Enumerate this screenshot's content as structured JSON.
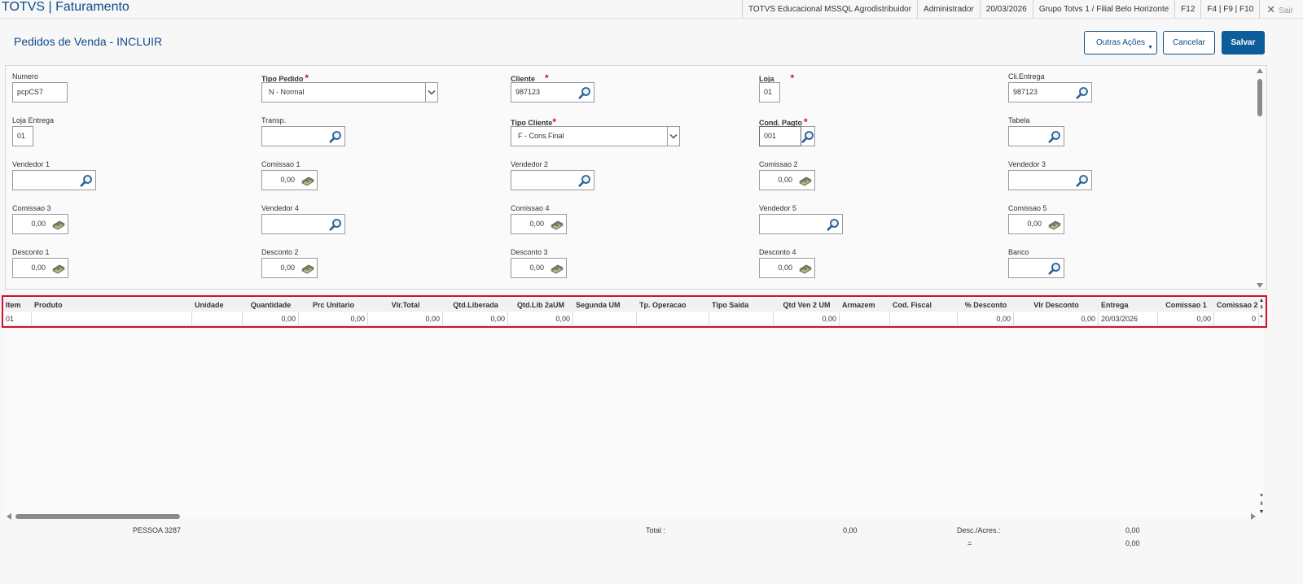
{
  "topbar": {
    "app_title": "TOTVS | Faturamento",
    "environment": "TOTVS Educacional MSSQL Agrodistribuidor",
    "user": "Administrador",
    "date": "20/03/2026",
    "branch": "Grupo Totvs 1 / Filial Belo Horizonte",
    "key_f12": "F12",
    "keys_f4_f9_f10": "F4 | F9 | F10",
    "exit_label": "Sair"
  },
  "page": {
    "title": "Pedidos de Venda - INCLUIR",
    "btn_outras": "Outras Ações",
    "btn_cancelar": "Cancelar",
    "btn_salvar": "Salvar"
  },
  "form": {
    "numero": {
      "label": "Numero",
      "value": "pcpCS7"
    },
    "tipo_pedido": {
      "label": "Tipo Pedido",
      "value": "N - Normal"
    },
    "cliente": {
      "label": "Cliente",
      "value": "987123"
    },
    "loja": {
      "label": "Loja",
      "value": "01"
    },
    "cli_entrega": {
      "label": "Cli.Entrega",
      "value": "987123"
    },
    "loja_entrega": {
      "label": "Loja Entrega",
      "value": "01"
    },
    "transp": {
      "label": "Transp.",
      "value": ""
    },
    "tipo_cliente": {
      "label": "Tipo Cliente",
      "value": "F - Cons.Final"
    },
    "cond_pagto": {
      "label": "Cond. Pagto",
      "value": "001"
    },
    "tabela": {
      "label": "Tabela",
      "value": ""
    },
    "vendedor1": {
      "label": "Vendedor 1",
      "value": ""
    },
    "comissao1": {
      "label": "Comissao 1",
      "value": "0,00"
    },
    "vendedor2": {
      "label": "Vendedor 2",
      "value": ""
    },
    "comissao2": {
      "label": "Comissao 2",
      "value": "0,00"
    },
    "vendedor3": {
      "label": "Vendedor 3",
      "value": ""
    },
    "comissao3": {
      "label": "Comissao 3",
      "value": "0,00"
    },
    "vendedor4": {
      "label": "Vendedor 4",
      "value": ""
    },
    "comissao4": {
      "label": "Comissao 4",
      "value": "0,00"
    },
    "vendedor5": {
      "label": "Vendedor 5",
      "value": ""
    },
    "comissao5": {
      "label": "Comissao 5",
      "value": "0,00"
    },
    "desconto1": {
      "label": "Desconto 1",
      "value": "0,00"
    },
    "desconto2": {
      "label": "Desconto 2",
      "value": "0,00"
    },
    "desconto3": {
      "label": "Desconto 3",
      "value": "0,00"
    },
    "desconto4": {
      "label": "Desconto 4",
      "value": "0,00"
    },
    "banco": {
      "label": "Banco",
      "value": ""
    }
  },
  "grid": {
    "headers": [
      "Item",
      "Produto",
      "Unidade",
      "Quantidade",
      "Prc Unitario",
      "Vlr.Total",
      "Qtd.Liberada",
      "Qtd.Lib 2aUM",
      "Segunda UM",
      "Tp. Operacao",
      "Tipo Saida",
      "Qtd Ven 2 UM",
      "Armazem",
      "Cod. Fiscal",
      "% Desconto",
      "Vlr Desconto",
      "Entrega",
      "Comissao 1",
      "Comissao 2"
    ],
    "rows": [
      [
        "01",
        "",
        "",
        "0,00",
        "0,00",
        "0,00",
        "0,00",
        "0,00",
        "",
        "",
        "",
        "0,00",
        "",
        "",
        "0,00",
        "0,00",
        "20/03/2026",
        "0,00",
        "0"
      ]
    ]
  },
  "footer": {
    "pessoa": "PESSOA 3287",
    "total_label": "Total :",
    "total_value": "0,00",
    "desc_label": "Desc./Acres.:",
    "desc_value": "0,00",
    "eq_label": "=",
    "eq_value": "0,00"
  },
  "colors": {
    "accent": "#0c4d8a",
    "required": "#d8112a",
    "highlight": "#d1102a"
  }
}
